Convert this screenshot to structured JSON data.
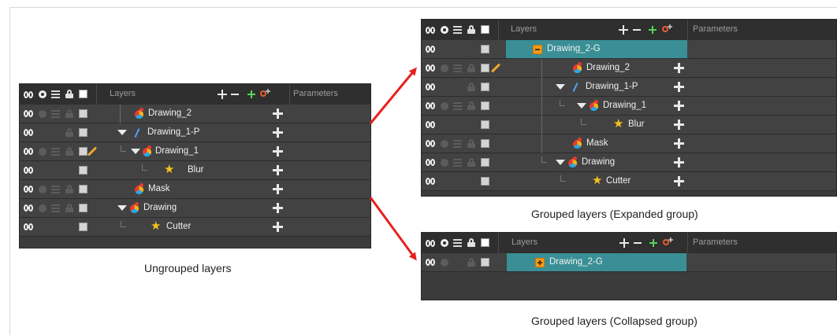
{
  "headers": {
    "layers_label": "Layers",
    "parameters_label": "Parameters"
  },
  "panel_ungrouped": {
    "caption": "Ungrouped layers",
    "rows": [
      {
        "name": "Drawing_2",
        "icon": "drawing-icon"
      },
      {
        "name": "Drawing_1-P",
        "icon": "peg-icon"
      },
      {
        "name": "Drawing_1",
        "icon": "drawing-icon"
      },
      {
        "name": "Blur",
        "icon": "star-icon"
      },
      {
        "name": "Mask",
        "icon": "drawing-icon"
      },
      {
        "name": "Drawing",
        "icon": "drawing-icon"
      },
      {
        "name": "Cutter",
        "icon": "star-icon"
      }
    ]
  },
  "panel_expanded": {
    "caption": "Grouped layers (Expanded group)",
    "group_name": "Drawing_2-G",
    "rows": [
      {
        "name": "Drawing_2",
        "icon": "drawing-icon"
      },
      {
        "name": "Drawing_1-P",
        "icon": "peg-icon"
      },
      {
        "name": "Drawing_1",
        "icon": "drawing-icon"
      },
      {
        "name": "Blur",
        "icon": "star-icon"
      },
      {
        "name": "Mask",
        "icon": "drawing-icon"
      },
      {
        "name": "Drawing",
        "icon": "drawing-icon"
      },
      {
        "name": "Cutter",
        "icon": "star-icon"
      }
    ]
  },
  "panel_collapsed": {
    "caption": "Grouped layers (Collapsed group)",
    "group_name": "Drawing_2-G"
  },
  "colors": {
    "selection": "#3a8f96",
    "arrow": "#e8201c",
    "panel_bg": "#424242",
    "header_bg": "#2f2f2f"
  }
}
